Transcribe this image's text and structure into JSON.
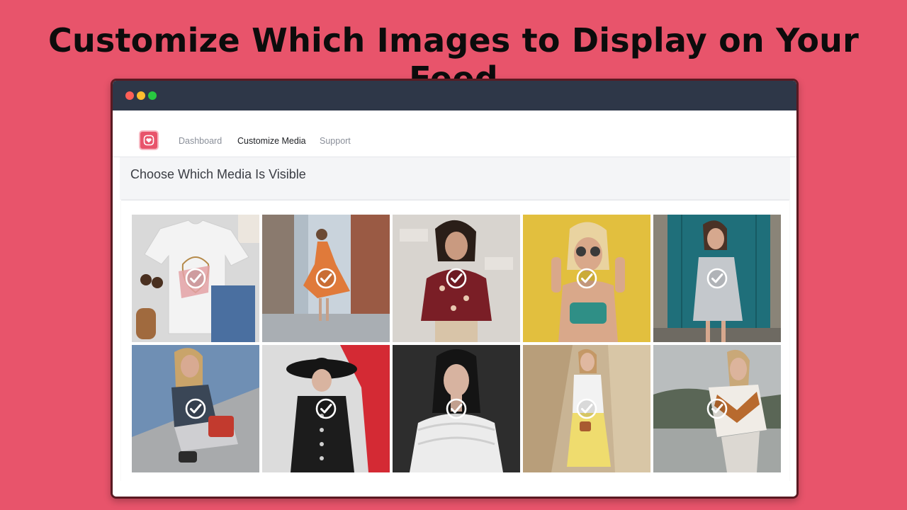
{
  "headline": "Customize Which Images to Display on Your Feed",
  "nav": {
    "items": [
      "Dashboard",
      "Customize Media",
      "Support"
    ],
    "active": "Customize Media"
  },
  "page": {
    "title": "Choose Which Media Is Visible"
  },
  "icons": {
    "logo": "instagram-heart-icon",
    "tile_check": "check-circle-icon"
  },
  "colors": {
    "background": "#e8546b",
    "titlebar": "#2e3748",
    "accent": "#e8546b"
  },
  "media": [
    {
      "id": "tshirt-flatlay",
      "selected": true
    },
    {
      "id": "orange-dress-street",
      "selected": true
    },
    {
      "id": "floral-top-brick",
      "selected": true
    },
    {
      "id": "sunglasses-yellow-wall",
      "selected": true
    },
    {
      "id": "teal-door-dress",
      "selected": true
    },
    {
      "id": "sitting-stairs",
      "selected": true
    },
    {
      "id": "black-hat-coat",
      "selected": true
    },
    {
      "id": "white-ruffle-dark",
      "selected": true
    },
    {
      "id": "yellow-skirt-hill",
      "selected": true
    },
    {
      "id": "sweater-lake",
      "selected": true
    }
  ]
}
